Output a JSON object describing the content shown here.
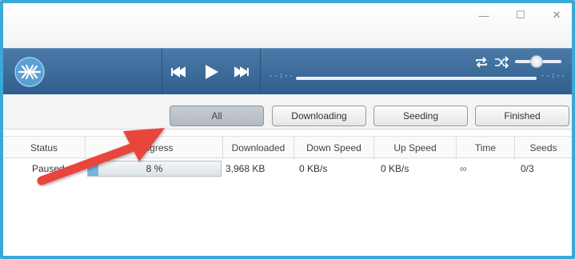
{
  "window": {
    "minimize_glyph": "—",
    "maximize_glyph": "☐",
    "close_glyph": "✕"
  },
  "player": {
    "logo_icon": "frostwire-logo-icon",
    "time_elapsed": "--:--",
    "time_remaining": "--:--",
    "controls": [
      "previous-track-icon",
      "play-icon",
      "next-track-icon"
    ],
    "modes": [
      "repeat-icon",
      "shuffle-icon"
    ],
    "volume": 0.55
  },
  "filters": [
    {
      "label": "All",
      "active": true
    },
    {
      "label": "Downloading",
      "active": false
    },
    {
      "label": "Seeding",
      "active": false
    },
    {
      "label": "Finished",
      "active": false
    }
  ],
  "table": {
    "columns": [
      "Status",
      "Progress",
      "Downloaded",
      "Down Speed",
      "Up Speed",
      "Time",
      "Seeds"
    ],
    "rows": [
      {
        "status": "Paused",
        "progress_text": "8 %",
        "progress_value": 0.08,
        "downloaded": "3,968 KB",
        "down_speed": "0 KB/s",
        "up_speed": "0 KB/s",
        "time": "∞",
        "seeds": "0/3"
      }
    ]
  },
  "colors": {
    "frame_border": "#3aa8d8",
    "player_bar": "#3e6c9b",
    "annotation_arrow": "#e8453c"
  }
}
